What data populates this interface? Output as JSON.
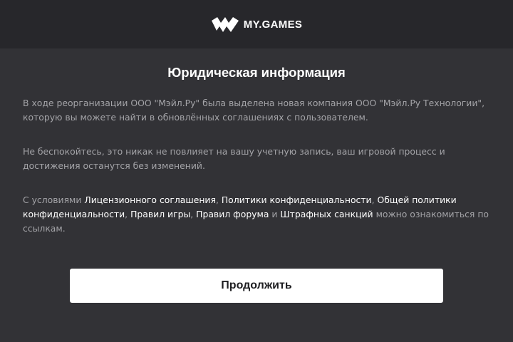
{
  "header": {
    "logo_text": "MY.GAMES",
    "logo_icon": "my-games-m-icon"
  },
  "dialog": {
    "title": "Юридическая информация",
    "paragraph1": "В ходе реорганизации ООО \"Мэйл.Ру\" была выделена новая компания ООО \"Мэйл.Ру Технологии\", которую вы можете найти в обновлённых соглашениях с пользователем.",
    "paragraph2": "Не беспокойтесь, это никак не повлияет на вашу учетную запись, ваш игровой процесс и достижения останутся без изменений.",
    "paragraph3": {
      "prefix": "С условиями ",
      "link_license": "Лицензионного соглашения",
      "sep1": ", ",
      "link_privacy": "Политики конфиденциальности",
      "sep2": ", ",
      "link_general_privacy": "Общей политики конфиденциальности",
      "sep3": ", ",
      "link_game_rules": "Правил игры",
      "sep4": ", ",
      "link_forum_rules": "Правил форума",
      "sep5": " и ",
      "link_penalties": "Штрафных санкций",
      "suffix": " можно ознакомиться по ссылкам."
    },
    "continue_label": "Продолжить"
  },
  "colors": {
    "background": "#323236",
    "header_background": "#27272b",
    "body_text": "#a4a4a8",
    "link_text": "#ffffff",
    "button_background": "#ffffff",
    "button_text": "#1f1f22"
  }
}
